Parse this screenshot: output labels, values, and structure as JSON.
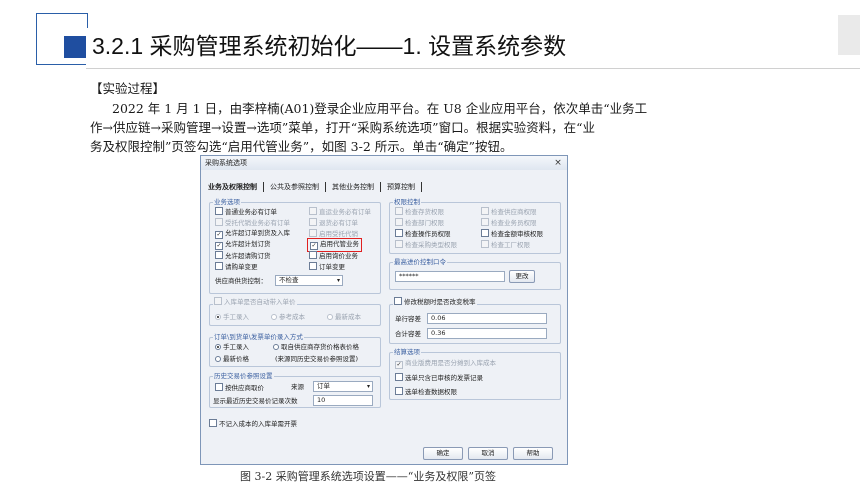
{
  "slide": {
    "title": "3.2.1 采购管理系统初始化——1. 设置系统参数",
    "section_label": "【实验过程】",
    "paragraph_lines": [
      "2022 年 1 月 1 日，由李梓楠(A01)登录企业应用平台。在 U8 企业应用平台，依次单击“业务工",
      "作→供应链→采购管理→设置→选项”菜单，打开“采购系统选项”窗口。根据实验资料，在“业",
      "务及权限控制”页签勾选“启用代管业务”，如图 3-2 所示。单击“确定”按钮。"
    ],
    "caption": "图 3-2  采购管理系统选项设置——“业务及权限”页签"
  },
  "dialog": {
    "title": "采购系统选项",
    "close": "×",
    "tabs": [
      "业务及权限控制",
      "公共及参照控制",
      "其他业务控制",
      "预算控制"
    ],
    "business_options": {
      "legend": "业务选项",
      "items": [
        {
          "label": "普通业务必有订单",
          "checked": false,
          "disabled": false
        },
        {
          "label": "直运业务必有订单",
          "checked": false,
          "disabled": true
        },
        {
          "label": "受托代销业务必有订单",
          "checked": false,
          "disabled": true
        },
        {
          "label": "退货必有订单",
          "checked": false,
          "disabled": true
        },
        {
          "label": "允许超订单到货及入库",
          "checked": true,
          "disabled": false
        },
        {
          "label": "启用受托代销",
          "checked": false,
          "disabled": true
        },
        {
          "label": "允许超计划订货",
          "checked": true,
          "disabled": false
        },
        {
          "label": "启用代管业务",
          "checked": true,
          "disabled": false
        },
        {
          "label": "允许超请购订货",
          "checked": false,
          "disabled": false
        },
        {
          "label": "启用询价业务",
          "checked": false,
          "disabled": false
        },
        {
          "label": "请购单变更",
          "checked": false,
          "disabled": false
        },
        {
          "label": "订单变更",
          "checked": false,
          "disabled": false
        }
      ],
      "supplier_control_label": "供应商供货控制：",
      "supplier_control_value": "不检查"
    },
    "permission_control": {
      "legend": "权限控制",
      "items": [
        {
          "label": "检查存货权限",
          "checked": false,
          "disabled": true
        },
        {
          "label": "检查供应商权限",
          "checked": false,
          "disabled": true
        },
        {
          "label": "检查部门权限",
          "checked": false,
          "disabled": true
        },
        {
          "label": "检查业务员权限",
          "checked": false,
          "disabled": true
        },
        {
          "label": "检查操作员权限",
          "checked": false,
          "disabled": false
        },
        {
          "label": "检查金额审核权限",
          "checked": false,
          "disabled": false
        },
        {
          "label": "检查采购类型权限",
          "checked": false,
          "disabled": true
        },
        {
          "label": "检查工厂权限",
          "checked": false,
          "disabled": true
        }
      ]
    },
    "max_price": {
      "legend": "最高进价控制口令",
      "password": "******",
      "button": "更改"
    },
    "auto_price": {
      "label": "入库单是否自动带入单价",
      "options": [
        "手工录入",
        "参考成本",
        "最新成本"
      ]
    },
    "tax": {
      "label": "修改税额时是否改变税率",
      "unit_tolerance_label": "单行容差",
      "unit_tolerance_value": "0.06",
      "total_tolerance_label": "合计容差",
      "total_tolerance_value": "0.36"
    },
    "price_mode": {
      "legend": "订单\\到货单\\发票单价录入方式",
      "options": [
        "手工录入",
        "取自供应商存货价格表价格",
        "最新价格",
        "(来源同历史交易价参照设置)"
      ]
    },
    "history": {
      "legend": "历史交易价参照设置",
      "by_supplier_label": "按供应商取价",
      "source_label": "来源",
      "source_value": "订单",
      "count_label": "显示最近历史交易价记录次数",
      "count_value": "10"
    },
    "settlement": {
      "legend": "结算选项",
      "items": [
        {
          "label": "商业版费用是否分摊到入库成本",
          "checked": true,
          "disabled": true
        },
        {
          "label": "选单只含已审核的发票记录",
          "checked": false,
          "disabled": false
        },
        {
          "label": "选单检查数据权限",
          "checked": false,
          "disabled": false
        }
      ]
    },
    "no_cost_label": "不记入成本的入库单需开票",
    "buttons": {
      "ok": "确定",
      "cancel": "取消",
      "help": "帮助"
    }
  }
}
